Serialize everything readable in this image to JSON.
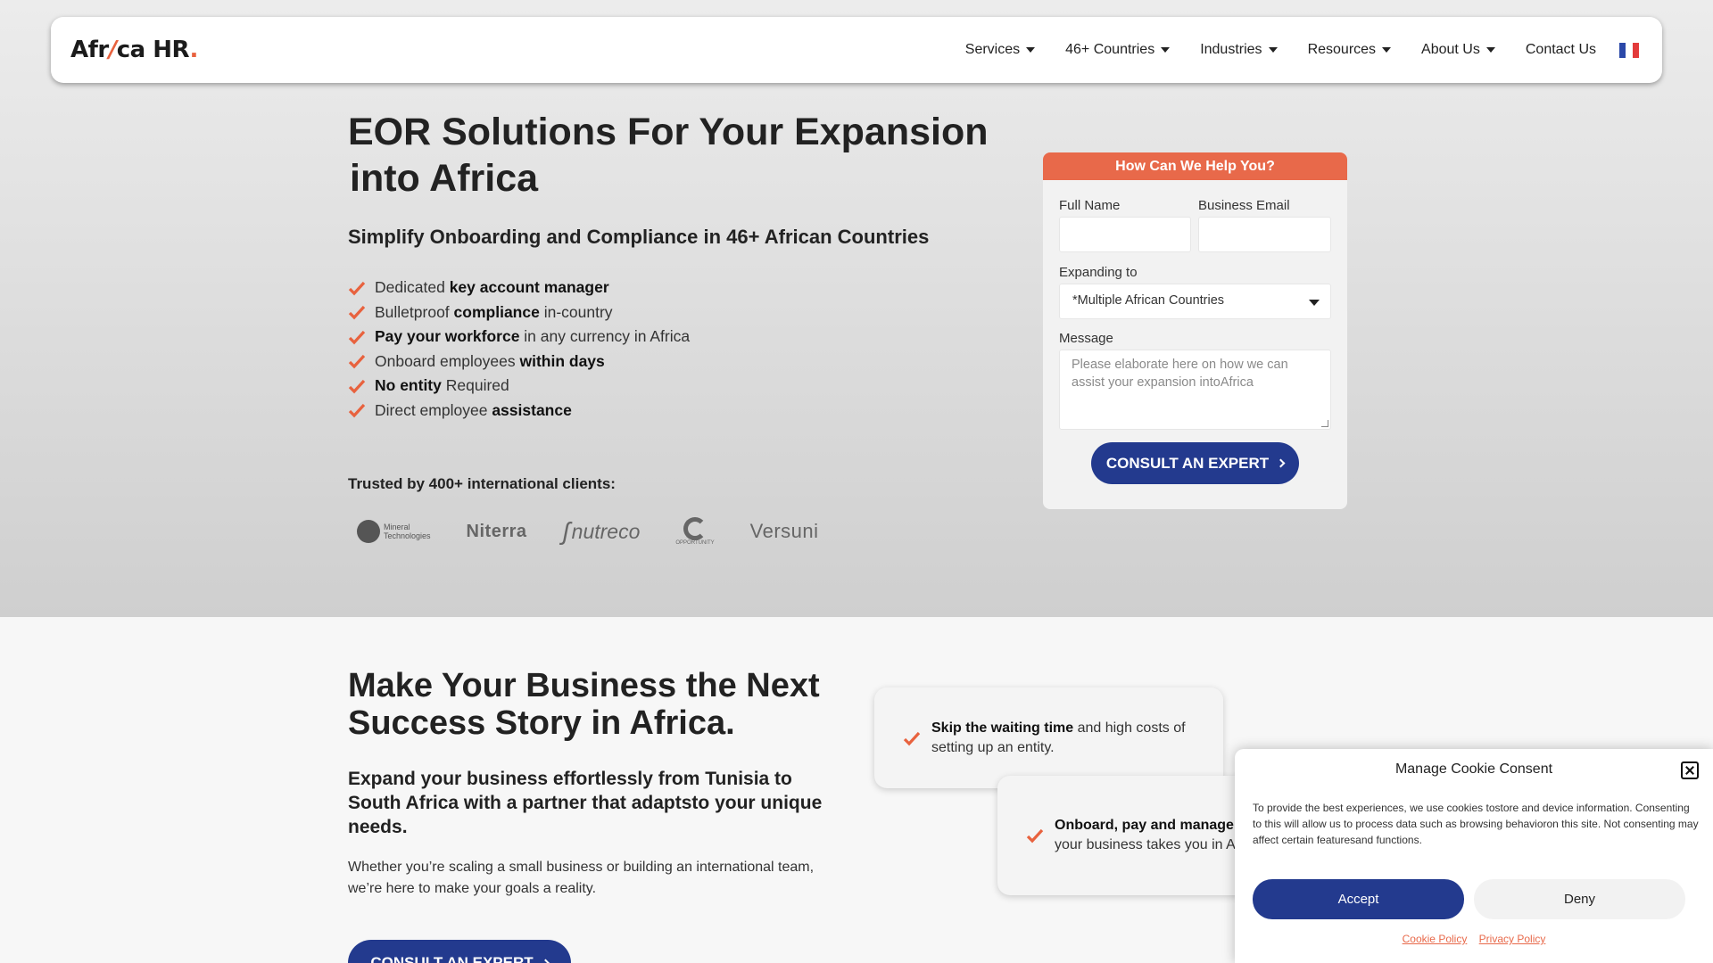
{
  "colors": {
    "accent": "#e8694a",
    "primary": "#233a8e",
    "check": "#e8623e"
  },
  "nav": {
    "logo_main": "Afr",
    "logo_slash": "/",
    "logo_rest": "ca HR",
    "logo_dot": ".",
    "items": [
      {
        "label": "Services",
        "has_caret": true
      },
      {
        "label": "46+ Countries",
        "has_caret": true
      },
      {
        "label": "Industries",
        "has_caret": true
      },
      {
        "label": "Resources",
        "has_caret": true
      },
      {
        "label": "About Us",
        "has_caret": true
      },
      {
        "label": "Contact Us",
        "has_caret": false
      }
    ],
    "flag_icon": "french-flag-icon"
  },
  "hero": {
    "title_line1": "EOR Solutions For Your Expansion",
    "title_line2": "into Africa",
    "subtitle": "Simplify Onboarding and Compliance in 46+ African Countries",
    "benefits": [
      {
        "pre": "Dedicated ",
        "bold": "key account manager",
        "post": ""
      },
      {
        "pre": "Bulletproof ",
        "bold": "compliance",
        "post": " in-country"
      },
      {
        "pre": "",
        "bold": "Pay your workforce",
        "post": " in any currency in Africa"
      },
      {
        "pre": "Onboard employees ",
        "bold": "within days",
        "post": ""
      },
      {
        "pre": "",
        "bold": "No entity",
        "post": " Required"
      },
      {
        "pre": "Direct employee ",
        "bold": "assistance",
        "post": ""
      }
    ],
    "trusted": "Trusted by 400+ international clients:",
    "clients": {
      "mineral_line1": "Mineral",
      "mineral_line2": "Technologies",
      "niterra": "Niterra",
      "nutreco": "nutreco",
      "opportunity": "OPPORTUNITY",
      "versuni": "Versuni"
    }
  },
  "form": {
    "header": "How Can We Help You?",
    "full_name_label": "Full Name",
    "business_email_label": "Business Email",
    "expanding_label": "Expanding to",
    "expanding_value": "*Multiple African Countries",
    "message_label": "Message",
    "message_placeholder": "Please elaborate here on how we can assist your expansion intoAfrica",
    "submit": "CONSULT AN EXPERT"
  },
  "section2": {
    "title": "Make Your Business the Next Success Story in Africa.",
    "subtitle": "Expand your business effortlessly from Tunisia to South Africa with a partner that adaptsto your unique needs.",
    "body": "Whether you’re scaling a small business or building an international team, we’re here to make your goals a reality.",
    "cta": "CONSULT AN EXPERT",
    "feature1_bold": "Skip the waiting time",
    "feature1_rest": " and high costs of setting up an entity.",
    "feature2_bold": "Onboard, pay and manage",
    "feature2_rest": " wherever your business takes you in Africa."
  },
  "cookie": {
    "title": "Manage Cookie Consent",
    "text": "To provide the best experiences, we use cookies tostore and device information. Consenting to this will allow us to process data such as browsing behavioron this site. Not consenting may affect certain featuresand functions.",
    "accept": "Accept",
    "deny": "Deny",
    "cookie_policy": "Cookie Policy",
    "privacy_policy": "Privacy Policy"
  }
}
